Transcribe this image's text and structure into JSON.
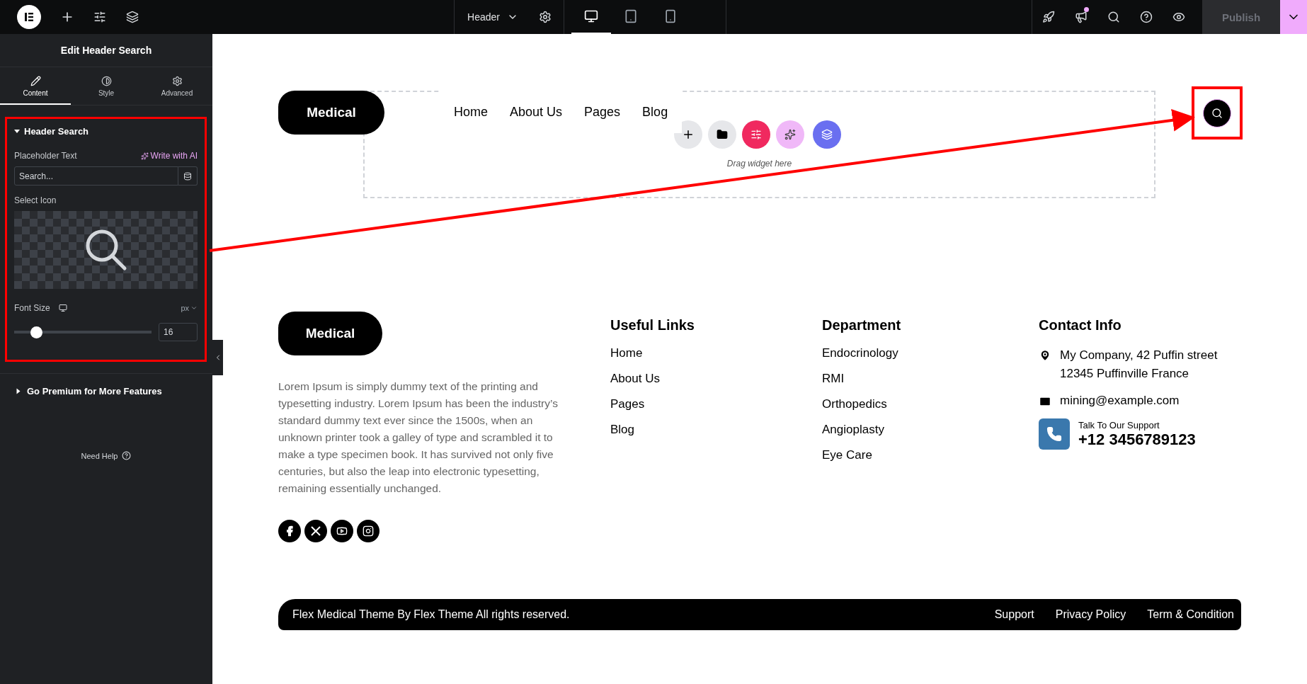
{
  "topbar": {
    "document": "Header",
    "publish": "Publish",
    "devices": [
      {
        "kind": "desktop",
        "selected": true
      },
      {
        "kind": "tablet",
        "selected": false
      },
      {
        "kind": "mobile",
        "selected": false
      }
    ]
  },
  "panel": {
    "title": "Edit Header Search",
    "tabs": [
      {
        "label": "Content",
        "kind": "pencil",
        "selected": true
      },
      {
        "label": "Style",
        "kind": "contrast",
        "selected": false
      },
      {
        "label": "Advanced",
        "kind": "gear",
        "selected": false
      }
    ],
    "section": {
      "title": "Header Search",
      "expanded": true,
      "placeholder_label": "Placeholder Text",
      "ai_link": "Write with AI",
      "placeholder": "Search...",
      "icon_label": "Select Icon",
      "font_size_label": "Font Size",
      "unit": "px",
      "font_size": {
        "level": 0.16,
        "value": "16"
      }
    },
    "premium": {
      "title": "Go Premium for More Features",
      "expanded": false
    },
    "help": "Need Help"
  },
  "header": {
    "logo": "Medical",
    "nav": [
      "Home",
      "About Us",
      "Pages",
      "Blog"
    ],
    "drop_hint": "Drag widget here"
  },
  "footer": {
    "logo": "Medical",
    "about": "Lorem Ipsum is simply dummy text of the printing and typesetting industry. Lorem Ipsum has been the industry’s standard dummy text ever since the 1500s, when an unknown printer took a galley of type and scrambled it to make a type specimen book. It has survived not only five centuries, but also the leap into electronic typesetting, remaining essentially unchanged.",
    "columns": [
      {
        "title": "Useful Links",
        "links": [
          "Home",
          "About Us",
          "Pages",
          "Blog"
        ]
      },
      {
        "title": "Department",
        "links": [
          "Endocrinology",
          "RMI",
          "Orthopedics",
          "Angioplasty",
          "Eye Care"
        ]
      }
    ],
    "contact": {
      "title": "Contact Info",
      "address": "My Company, 42 Puffin street 12345 Puffinville France",
      "email": "mining@example.com",
      "support_label": "Talk To Our Support",
      "phone": "+12 3456789123"
    },
    "copyright": "Flex Medical Theme By Flex Theme All rights reserved.",
    "bottom_links": [
      "Support",
      "Privacy Policy",
      "Term & Condition"
    ]
  }
}
